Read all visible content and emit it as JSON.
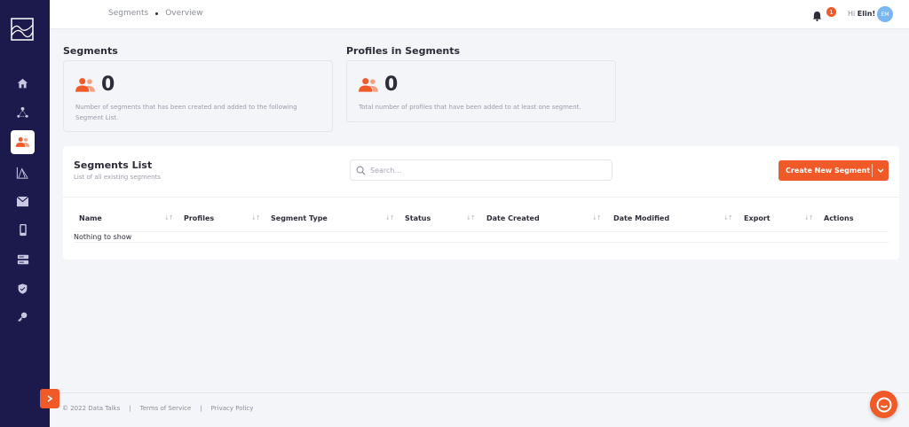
{
  "colors": {
    "sidebar": "#1c1a4d",
    "accent": "#f05a28",
    "background": "#f3f5f9",
    "avatar": "#7ab6ef"
  },
  "breadcrumb": {
    "section": "Segments",
    "page": "Overview"
  },
  "header": {
    "notification_count": "1",
    "greeting_prefix": "Hi",
    "user_name": "Elin!",
    "avatar_initials": "EM"
  },
  "sidebar": {
    "items": [
      {
        "icon": "home-icon"
      },
      {
        "icon": "network-icon"
      },
      {
        "icon": "users-icon",
        "active": true
      },
      {
        "icon": "chart-icon"
      },
      {
        "icon": "mail-icon"
      },
      {
        "icon": "mobile-icon"
      },
      {
        "icon": "server-icon"
      },
      {
        "icon": "shield-icon"
      },
      {
        "icon": "key-icon"
      }
    ]
  },
  "stats": [
    {
      "title": "Segments",
      "value": "0",
      "description_line1": "Number of segments that has been created and added to the following",
      "description_line2": "Segment List."
    },
    {
      "title": "Profiles in Segments",
      "value": "0",
      "description_line1": "Total number of profiles that have been added to at least one segment.",
      "description_line2": ""
    }
  ],
  "segments_list": {
    "title": "Segments List",
    "subtitle": "List of all existing segments",
    "search_placeholder": "Search...",
    "create_button": "Create New Segment",
    "columns": [
      "Name",
      "Profiles",
      "Segment Type",
      "Status",
      "Date Created",
      "Date Modified",
      "Export",
      "Actions"
    ],
    "empty_message": "Nothing to show"
  },
  "footer": {
    "copyright": "© 2022 Data Talks",
    "separator": "|",
    "terms": "Terms of Service",
    "privacy": "Privacy Policy"
  }
}
